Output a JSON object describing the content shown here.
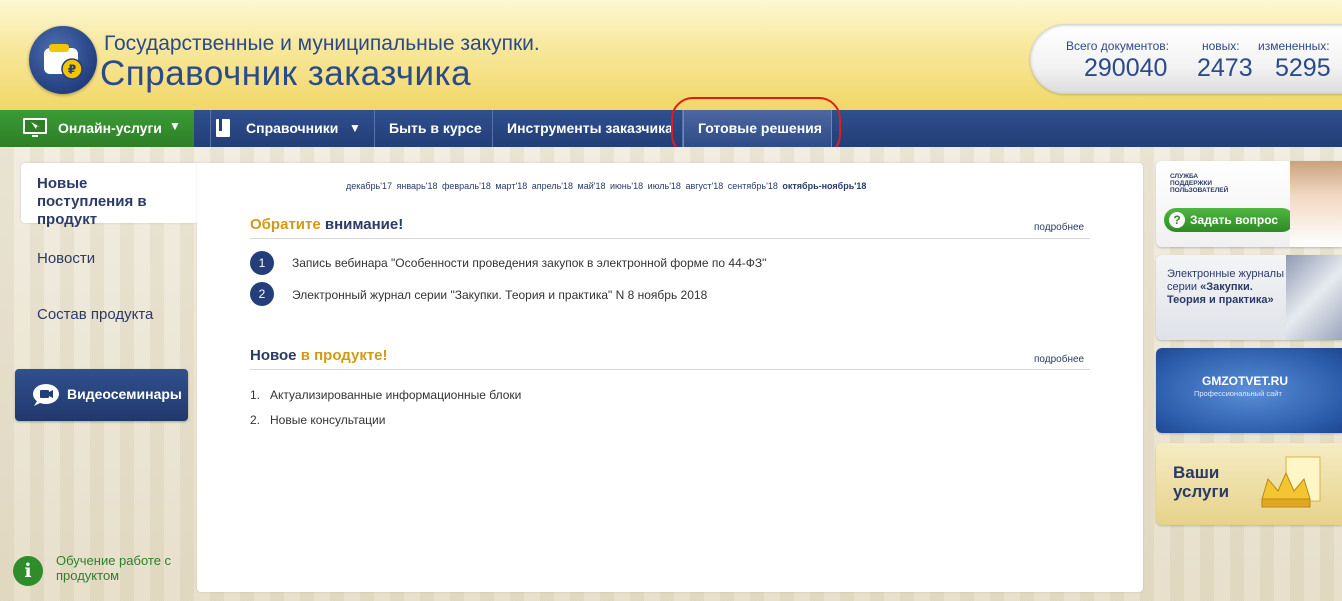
{
  "header": {
    "title_line1": "Государственные и муниципальные закупки.",
    "title_line2": "Справочник заказчика",
    "counters": {
      "total_label": "Всего документов:",
      "total_value": "290040",
      "new_label": "новых:",
      "new_value": "2473",
      "changed_label": "измененных:",
      "changed_value": "5295"
    }
  },
  "nav": {
    "online_services": "Онлайн-услуги",
    "items": [
      "Справочники",
      "Быть в курсе",
      "Инструменты заказчика",
      "Готовые решения"
    ],
    "active": "Готовые решения"
  },
  "sidebar": {
    "active_item": "Новые поступления в продукт",
    "items": [
      "Новости",
      "Состав продукта"
    ],
    "video_button": "Видеосеминары",
    "help_text": "Обучение работе с продуктом"
  },
  "main": {
    "months": [
      "декабрь'17",
      "январь'18",
      "февраль'18",
      "март'18",
      "апрель'18",
      "май'18",
      "июнь'18",
      "июль'18",
      "август'18",
      "сентябрь'18"
    ],
    "current_month": "октябрь-ноябрь'18",
    "attention": {
      "title_a": "Обратите",
      "title_b": "внимание!",
      "more": "подробнее",
      "items": [
        "Запись вебинара \"Особенности проведения закупок в электронной форме по 44-ФЗ\"",
        "Электронный журнал серии \"Закупки. Теория и практика\" N 8 ноябрь 2018"
      ]
    },
    "new_in_product": {
      "title_a": "Новое",
      "title_b": "в продукте!",
      "more": "подробнее",
      "items": [
        "Актуализированные информационные блоки",
        "Новые консультации"
      ]
    }
  },
  "banners": {
    "support_small": "СЛУЖБА ПОДДЕРЖКИ ПОЛЬЗОВАТЕЛЕЙ",
    "ask_button": "Задать вопрос",
    "journals_text": "Электронные журналы серии",
    "journals_bold": "«Закупки. Теория и практика»",
    "site_title": "GMZOTVET.RU",
    "site_sub": "Профессиональный сайт",
    "services": "Ваши услуги"
  },
  "colors": {
    "brand_blue": "#233e78",
    "brand_green": "#2e7f28",
    "accent_gold": "#d29a12",
    "highlight_red": "#e21b1b"
  }
}
